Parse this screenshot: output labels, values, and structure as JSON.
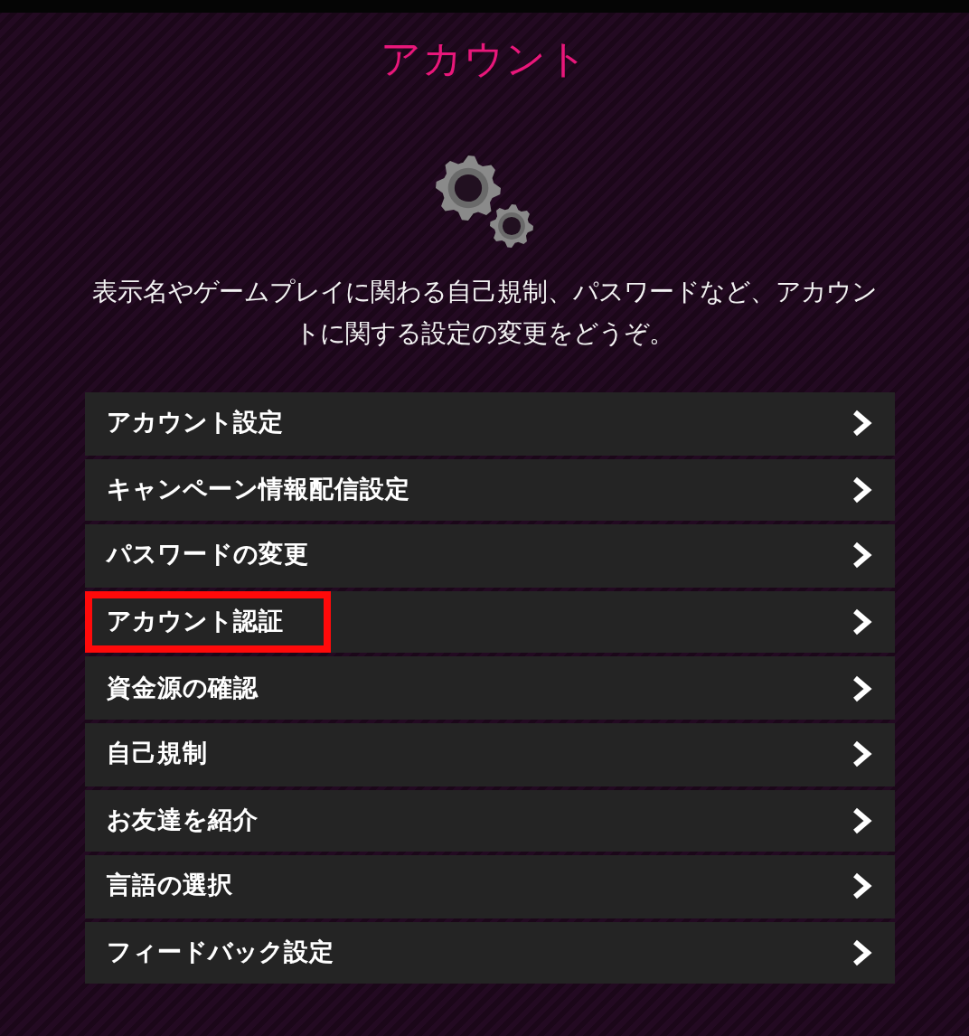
{
  "title": "アカウント",
  "description": "表示名やゲームプレイに関わる自己規制、パスワードなど、アカウントに関する設定の変更をどうぞ。",
  "menu": [
    {
      "label": "アカウント設定",
      "highlighted": false
    },
    {
      "label": "キャンペーン情報配信設定",
      "highlighted": false
    },
    {
      "label": "パスワードの変更",
      "highlighted": false
    },
    {
      "label": "アカウント認証",
      "highlighted": true
    },
    {
      "label": "資金源の確認",
      "highlighted": false
    },
    {
      "label": "自己規制",
      "highlighted": false
    },
    {
      "label": "お友達を紹介",
      "highlighted": false
    },
    {
      "label": "言語の選択",
      "highlighted": false
    },
    {
      "label": "フィードバック設定",
      "highlighted": false
    }
  ]
}
